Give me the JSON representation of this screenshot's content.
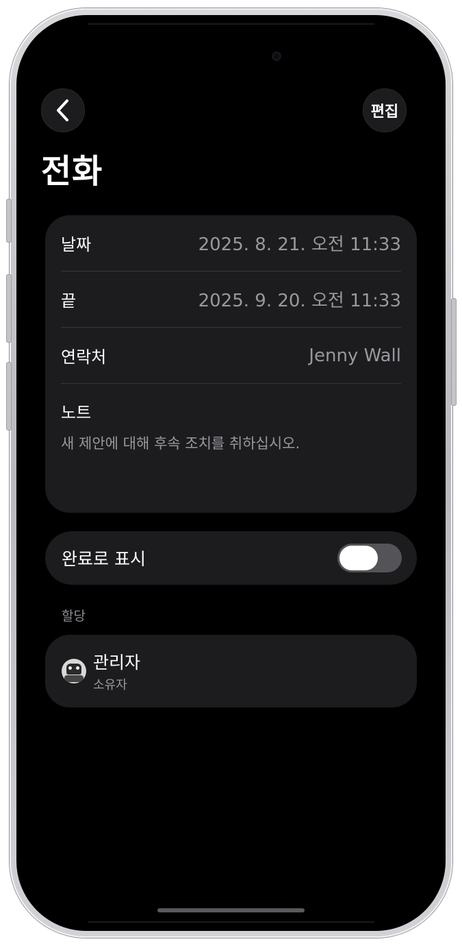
{
  "header": {
    "back_icon": "chevron-left-icon",
    "edit_label": "편집",
    "title": "전화"
  },
  "details": {
    "rows": [
      {
        "label": "날짜",
        "value": "2025. 8. 21. 오전 11:33"
      },
      {
        "label": "끝",
        "value": "2025. 9. 20. 오전 11:33"
      },
      {
        "label": "연락처",
        "value": "Jenny Wall"
      }
    ],
    "note": {
      "label": "노트",
      "text": "새 제안에 대해 후속 조치를 취하십시오."
    }
  },
  "completed": {
    "label": "완료로 표시",
    "toggle_on": false
  },
  "assignment": {
    "section_label": "할당",
    "name": "관리자",
    "role": "소유자"
  }
}
